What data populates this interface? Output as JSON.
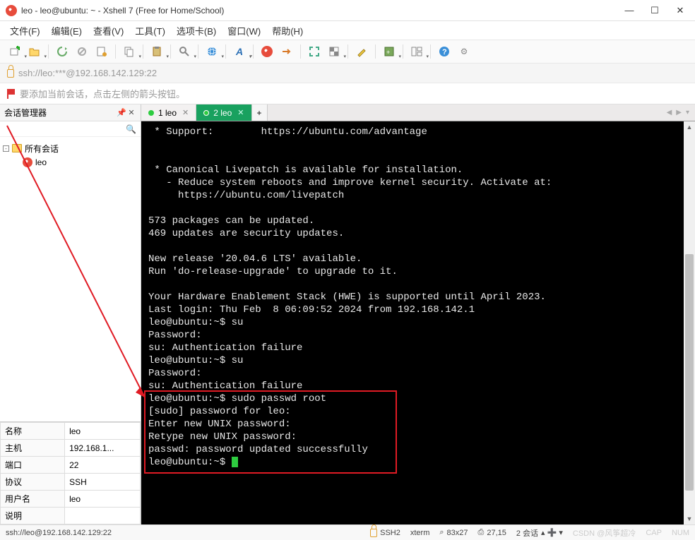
{
  "window": {
    "title": "leo - leo@ubuntu: ~ - Xshell 7 (Free for Home/School)"
  },
  "menu": {
    "file": "文件(F)",
    "edit": "编辑(E)",
    "view": "查看(V)",
    "tools": "工具(T)",
    "tab": "选项卡(B)",
    "window": "窗口(W)",
    "help": "帮助(H)"
  },
  "address": "ssh://leo:***@192.168.142.129:22",
  "hint": "要添加当前会话，点击左侧的箭头按钮。",
  "sidebar": {
    "title": "会话管理器",
    "root": "所有会话",
    "items": [
      {
        "label": "leo"
      }
    ]
  },
  "props": {
    "rows": [
      {
        "k": "名称",
        "v": "leo"
      },
      {
        "k": "主机",
        "v": "192.168.1..."
      },
      {
        "k": "端口",
        "v": "22"
      },
      {
        "k": "协议",
        "v": "SSH"
      },
      {
        "k": "用户名",
        "v": "leo"
      },
      {
        "k": "说明",
        "v": ""
      }
    ]
  },
  "tabs": [
    {
      "label": "1 leo",
      "active": false
    },
    {
      "label": "2 leo",
      "active": true
    }
  ],
  "terminal": {
    "lines": [
      " * Support:        https://ubuntu.com/advantage",
      "",
      "",
      " * Canonical Livepatch is available for installation.",
      "   - Reduce system reboots and improve kernel security. Activate at:",
      "     https://ubuntu.com/livepatch",
      "",
      "573 packages can be updated.",
      "469 updates are security updates.",
      "",
      "New release '20.04.6 LTS' available.",
      "Run 'do-release-upgrade' to upgrade to it.",
      "",
      "Your Hardware Enablement Stack (HWE) is supported until April 2023.",
      "Last login: Thu Feb  8 06:09:52 2024 from 192.168.142.1",
      "leo@ubuntu:~$ su",
      "Password:",
      "su: Authentication failure",
      "leo@ubuntu:~$ su",
      "Password:",
      "su: Authentication failure",
      "leo@ubuntu:~$ sudo passwd root",
      "[sudo] password for leo:",
      "Enter new UNIX password:",
      "Retype new UNIX password:",
      "passwd: password updated successfully",
      "leo@ubuntu:~$ "
    ]
  },
  "status": {
    "conn": "ssh://leo@192.168.142.129:22",
    "ssh": "SSH2",
    "term": "xterm",
    "size": "83x27",
    "pos": "27,15",
    "sessions": "2 会话",
    "watermark": "CSDN @风筝超冷",
    "cap": "CAP",
    "num": "NUM"
  }
}
